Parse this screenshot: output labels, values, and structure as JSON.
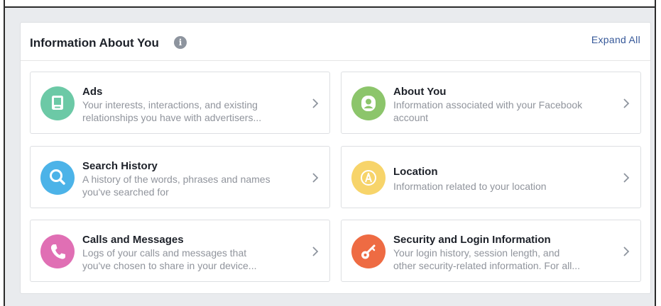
{
  "panel": {
    "title": "Information About You",
    "info_icon_glyph": "i",
    "expand_all": "Expand All"
  },
  "cards": [
    {
      "title": "Ads",
      "desc_lines": [
        "Your interests, interactions, and existing",
        "relationships you have with advertisers..."
      ],
      "icon": "ads-icon",
      "color": "#6cc9a6"
    },
    {
      "title": "About You",
      "desc_lines": [
        "Information associated with your Facebook",
        "account"
      ],
      "icon": "person-icon",
      "color": "#8cc56b"
    },
    {
      "title": "Search History",
      "desc_lines": [
        "A history of the words, phrases and names",
        "you've searched for"
      ],
      "icon": "search-icon",
      "color": "#4cb3e8"
    },
    {
      "title": "Location",
      "desc_lines": [
        "Information related to your location"
      ],
      "icon": "location-icon",
      "color": "#f7d46a"
    },
    {
      "title": "Calls and Messages",
      "desc_lines": [
        "Logs of your calls and messages that",
        "you've chosen to share in your device..."
      ],
      "icon": "phone-icon",
      "color": "#e06fb4"
    },
    {
      "title": "Security and Login Information",
      "desc_lines": [
        "Your login history, session length, and",
        "other security-related information. For all..."
      ],
      "icon": "key-icon",
      "color": "#ee6b43"
    }
  ],
  "chevron_icon": "chevron-right-icon"
}
